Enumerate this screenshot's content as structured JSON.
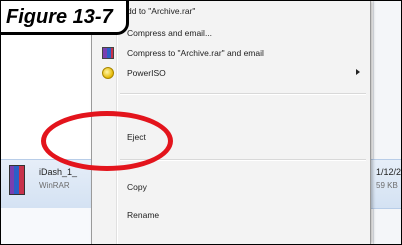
{
  "figure": {
    "label": "Figure 13-7"
  },
  "context_menu": {
    "items": [
      {
        "label": "dd to \"Archive.rar\"",
        "icon": ""
      },
      {
        "label": "Compress and email...",
        "icon": ""
      },
      {
        "label": "Compress to \"Archive.rar\" and email",
        "icon": "winrar-icon"
      },
      {
        "label": "PowerISO",
        "icon": "poweriso-icon",
        "submenu": true
      },
      {
        "label": "Eject"
      },
      {
        "label": "Copy"
      },
      {
        "label": "Rename"
      }
    ]
  },
  "file": {
    "name": "iDash_1_",
    "type": "WinRAR",
    "date": "1/12/2",
    "size": "59 KB"
  },
  "colors": {
    "highlight": "#e3141c",
    "menu_bg": "#f3f3f3",
    "selected_row": "#d4e2f3"
  }
}
